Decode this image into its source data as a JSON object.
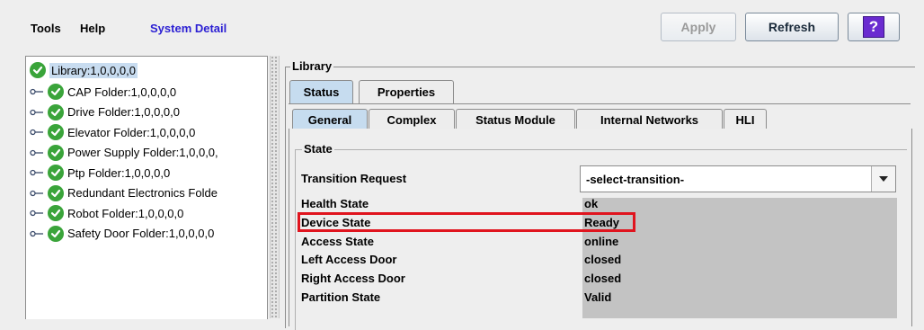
{
  "menu": {
    "tools": "Tools",
    "help": "Help",
    "system_detail": "System Detail"
  },
  "toolbar": {
    "apply_label": "Apply",
    "refresh_label": "Refresh",
    "help_icon": "?"
  },
  "tree": {
    "root": {
      "label": "Library:1,0,0,0,0",
      "icon": "check-circle-icon",
      "selected": true
    },
    "items": [
      {
        "label": "CAP Folder:1,0,0,0,0"
      },
      {
        "label": "Drive Folder:1,0,0,0,0"
      },
      {
        "label": "Elevator Folder:1,0,0,0,0"
      },
      {
        "label": "Power Supply Folder:1,0,0,0,"
      },
      {
        "label": "Ptp Folder:1,0,0,0,0"
      },
      {
        "label": "Redundant Electronics Folde"
      },
      {
        "label": "Robot Folder:1,0,0,0,0"
      },
      {
        "label": "Safety Door Folder:1,0,0,0,0"
      }
    ]
  },
  "library": {
    "title": "Library",
    "tabs": [
      {
        "label": "Status",
        "active": true
      },
      {
        "label": "Properties",
        "active": false
      }
    ],
    "subtabs": [
      {
        "label": "General",
        "active": true
      },
      {
        "label": "Complex",
        "active": false
      },
      {
        "label": "Status Module",
        "active": false
      },
      {
        "label": "Internal Networks",
        "active": false
      },
      {
        "label": "HLI",
        "active": false
      }
    ]
  },
  "state": {
    "title": "State",
    "transition_label": "Transition Request",
    "transition_value": "-select-transition-",
    "fields": [
      {
        "label": "Health State",
        "value": "ok"
      },
      {
        "label": "Device State",
        "value": "Ready",
        "highlighted": true
      },
      {
        "label": "Access State",
        "value": "online"
      },
      {
        "label": "Left Access Door",
        "value": "closed"
      },
      {
        "label": "Right Access Door",
        "value": "closed"
      },
      {
        "label": "Partition State",
        "value": "Valid"
      }
    ]
  },
  "colors": {
    "accent_link": "#2b1fd3",
    "status_ok": "#3aa43a",
    "highlight_box": "#e0141e",
    "selected_tab": "#c6dcef"
  }
}
